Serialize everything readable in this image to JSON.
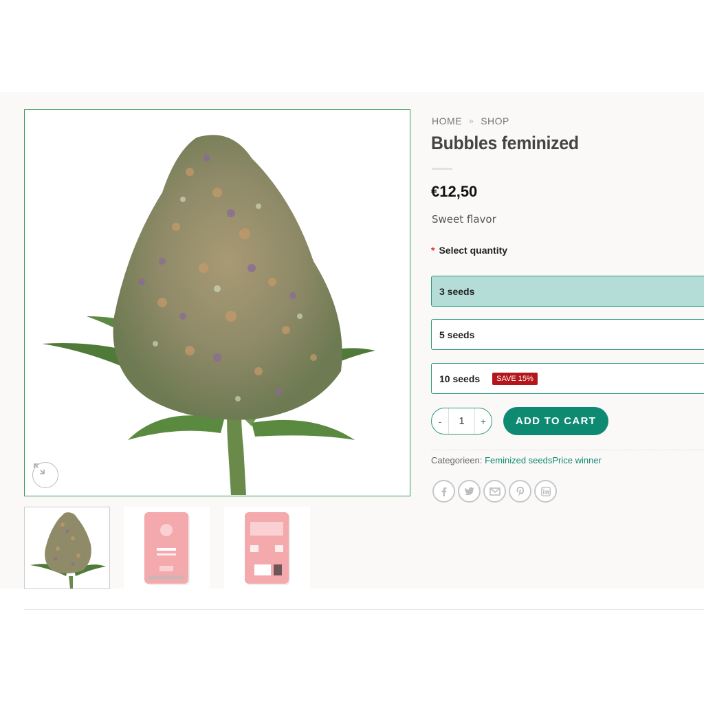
{
  "breadcrumb": {
    "home": "HOME",
    "separator": "»",
    "shop": "SHOP"
  },
  "product": {
    "title": "Bubbles feminized",
    "price": "€12,50",
    "short_description": "Sweet flavor"
  },
  "quantity_selector": {
    "required_marker": "*",
    "label": "Select quantity",
    "options": [
      {
        "label": "3 seeds",
        "selected": true
      },
      {
        "label": "5 seeds",
        "selected": false
      },
      {
        "label": "10 seeds",
        "selected": false,
        "badge": "SAVE 15%"
      }
    ]
  },
  "cart": {
    "minus_label": "-",
    "quantity_value": "1",
    "plus_label": "+",
    "add_to_cart_label": "ADD TO CART"
  },
  "meta": {
    "categories_label": "Categorieen:",
    "category_1": "Feminized seeds",
    "category_2": "Price winner"
  },
  "share_icons": [
    "facebook-icon",
    "twitter-icon",
    "email-icon",
    "pinterest-icon",
    "linkedin-icon"
  ],
  "colors": {
    "accent": "#0e8a72",
    "option_border": "#2a9a7c",
    "selected_option_bg": "#b5ddd8",
    "badge_bg": "#b3161b",
    "image_border": "#3a9a52",
    "packet_pink": "#f4a9ac"
  }
}
